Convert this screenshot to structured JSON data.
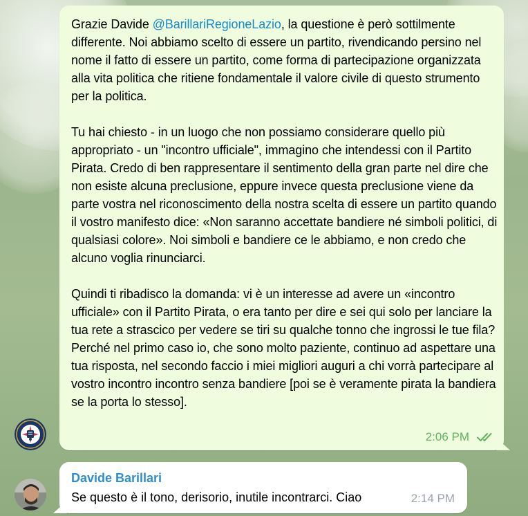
{
  "messages": {
    "outgoing": {
      "prefix": "Grazie Davide ",
      "mention": "@BarillariRegioneLazio",
      "line1_rest": ", la questione è però",
      "p1_rest": "sottilmente differente. Noi abbiamo scelto di essere un partito, rivendicando persino nel nome il fatto di essere un partito, come forma di partecipazione organizzata alla vita politica che ritiene fondamentale il valore civile di questo strumento per la politica.",
      "p2": "Tu hai chiesto - in un luogo che non possiamo considerare quello più appropriato - un \"incontro ufficiale\", immagino che intendessi con il Partito Pirata. Credo di ben rappresentare il sentimento della gran parte nel dire che non esiste alcuna preclusione, eppure invece questa preclusione viene da parte vostra nel riconoscimento della nostra scelta di essere un partito quando il vostro manifesto dice: «Non saranno accettate bandiere né simboli politici, di qualsiasi colore». Noi simboli e bandiere ce le abbiamo, e non credo che alcuno voglia rinunciarci.",
      "p3": "Quindi ti ribadisco la domanda: vi è un interesse ad avere un «incontro ufficiale» con il Partito Pirata, o era tanto per dire e sei qui solo per lanciare la tua rete a strascico per vedere se tiri su qualche tonno che ingrossi le tue fila? Perché nel primo caso io, che sono molto paziente, continuo ad aspettare una tua risposta, nel secondo faccio i miei migliori auguri a chi vorrà partecipare al vostro incontro incontro senza bandiere [poi se è veramente pirata la bandiera se la porta lo stesso].",
      "time": "2:06 PM",
      "status_icon": "double-check-icon"
    },
    "incoming": {
      "sender": "Davide Barillari",
      "text": "Se questo è il tono, derisorio, inutile incontrarci. Ciao",
      "time": "2:14 PM"
    }
  },
  "colors": {
    "outgoing_bubble": "#effdde",
    "incoming_bubble": "#ffffff",
    "mention": "#168acd",
    "sender_name": "#2f8dcc",
    "time_outgoing": "#5fb35e",
    "time_incoming": "#9aa5ad"
  },
  "avatars": {
    "outgoing": "cia-seal-avatar",
    "incoming": "user-photo-avatar"
  }
}
